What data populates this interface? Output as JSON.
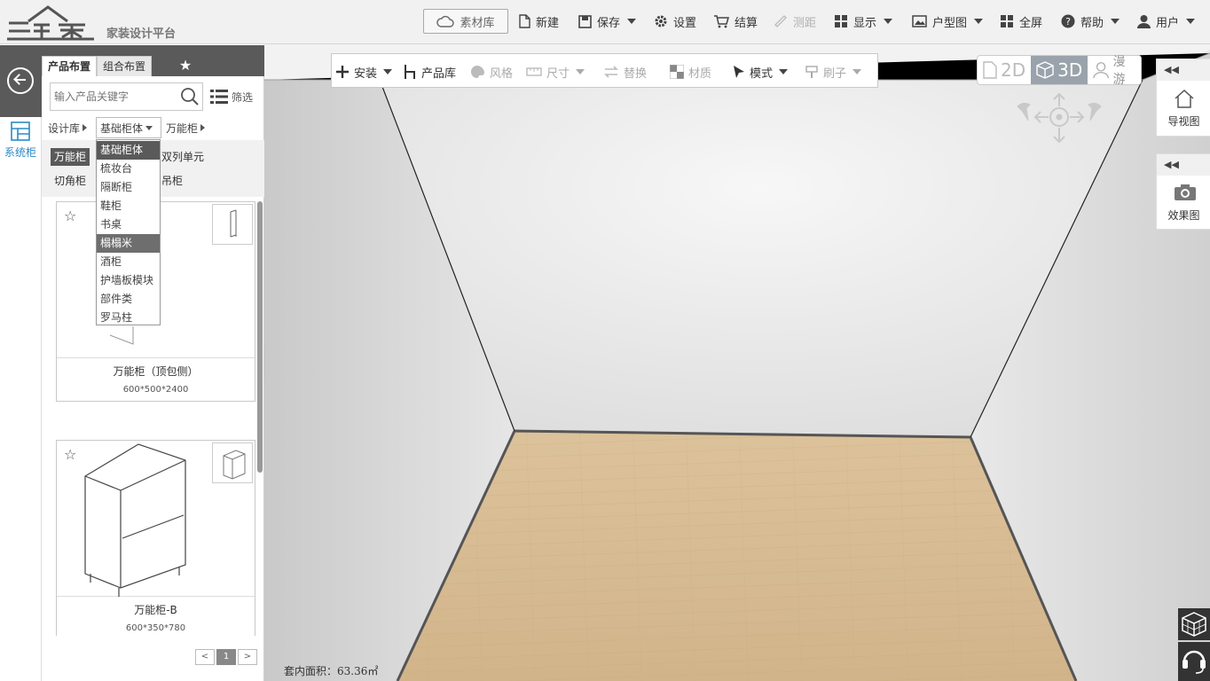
{
  "app": {
    "logo_text": "三维家",
    "subtitle": "家装设计平台"
  },
  "topbar": {
    "material_lib": "素材库",
    "new": "新建",
    "save": "保存",
    "settings": "设置",
    "checkout": "结算",
    "measure": "测距",
    "display": "显示",
    "floorplan": "户型图",
    "fullscreen": "全屏",
    "help": "帮助",
    "user": "用户"
  },
  "left_rail": {
    "item_label": "系统柜"
  },
  "panel": {
    "tabs": [
      "产品布置",
      "组合布置"
    ],
    "search_placeholder": "输入产品关键字",
    "filter_label": "筛选",
    "breadcrumb": [
      "设计库",
      "基础柜体",
      "万能柜"
    ],
    "subcategories": [
      "万能柜",
      "双列单元",
      "切角柜",
      "吊柜"
    ],
    "products": [
      {
        "name": "万能柜（顶包侧）",
        "dims": "600*500*2400"
      },
      {
        "name": "万能柜-B",
        "dims": "600*350*780"
      }
    ],
    "pager_current": "1"
  },
  "dropdown": {
    "items": [
      "基础柜体",
      "梳妆台",
      "隔断柜",
      "鞋柜",
      "书桌",
      "榻榻米",
      "酒柜",
      "护墙板模块",
      "部件类",
      "罗马柱"
    ],
    "selected": "基础柜体",
    "hovered": "榻榻米"
  },
  "toolbar2": {
    "install": "安装",
    "product_lib": "产品库",
    "style": "风格",
    "size": "尺寸",
    "replace": "替换",
    "material": "材质",
    "mode": "模式",
    "brush": "刷子"
  },
  "view_switch": {
    "v2d": "2D",
    "v3d": "3D",
    "roam": "漫游",
    "active": "3D"
  },
  "side_panels": {
    "nav_view": "导视图",
    "render_view": "效果图"
  },
  "status": {
    "area_text": "套内面积：63.36㎡"
  },
  "colors": {
    "dark_header": "#5a5a5a",
    "accent_blue": "#2b8ac6",
    "floor_wood": "#d9bd92"
  }
}
